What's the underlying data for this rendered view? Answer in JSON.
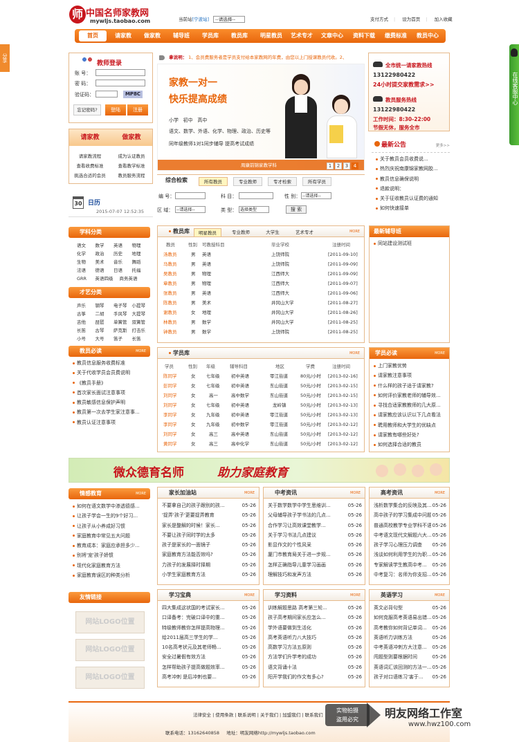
{
  "site": {
    "logo_glyph": "师",
    "logo_title": "中国名师家教网",
    "logo_url": "mywljs.taobao.com",
    "location_label": "当前站",
    "location_value": "[宁波站]",
    "location_select": "--请选择--",
    "links": [
      "支付方式",
      "设为首页",
      "加入收藏"
    ]
  },
  "nav": [
    "首页",
    "请家教",
    "做家教",
    "辅导班",
    "学员库",
    "教员库",
    "明星教员",
    "艺术专才",
    "文章中心",
    "资料下载",
    "缴费标准",
    "教员中心"
  ],
  "side_float": {
    "left": "分享",
    "right": "在线客服中心"
  },
  "login": {
    "title": "教师登录",
    "user": "账 号：",
    "pass": "密 码：",
    "code": "验证码：",
    "captcha": "MP8C",
    "forgot": "忘记密码?",
    "login_btn": "登陆",
    "reg_btn": "注册"
  },
  "guide": {
    "tab1": "请家教",
    "tab2": "做家教",
    "items1": [
      "请家教流程",
      "查看收费标准",
      "挑选合适的会员"
    ],
    "items2": [
      "成为认证教员",
      "查看教学标准",
      "教员服务流程"
    ]
  },
  "calendar": {
    "num": "30",
    "title": "日历",
    "date": "2015-07-07 12:52:35"
  },
  "notice": {
    "label": "拿说明：",
    "text": "1、会员费服务者是学员支付给本家教网的年费，由您以上门授课教员代收。2、"
  },
  "banner": {
    "line1": "家教一对一",
    "line2": "快乐提高成绩",
    "grades": "小学   初中   高中",
    "subjects": "语文、数学、外语、化学、物理、政治、历史等",
    "promo": "同年级教师1对1同步辅导 提高考试成绩",
    "caption": "周康前锦家教学科",
    "pages": [
      "1",
      "2",
      "3",
      "4"
    ]
  },
  "search": {
    "title": "综合检索",
    "tabs": [
      "所有教员",
      "专业教师",
      "专才检索",
      "所有学员"
    ],
    "id_label": "编 号：",
    "subject_label": "科 目：",
    "gender_label": "性 别：",
    "area_label": "区 域：",
    "type_label": "类 型：",
    "select_default": "--请选择--",
    "type_default": "选择类型",
    "btn": "搜 索"
  },
  "hotline": {
    "t1": "全市统一请家教热线",
    "p1": "13122980422",
    "s1": "24小时提交家教需求>>",
    "t2": "教员服务热线",
    "p2": "13122980422",
    "h1": "工作时间：8:30-22:00",
    "h2": "节假无休，服务全市"
  },
  "announce": {
    "title": "最新公告",
    "more": "更多>>",
    "items": [
      "关于教员会员收费说...",
      "热烈庆祝南康锦家教网胶...",
      "教员信息确保说明",
      "退款说明：",
      "关于征收教员认证费的通知",
      "如何快速接单"
    ]
  },
  "subjects": {
    "title": "学科分类",
    "items": [
      "语文",
      "数学",
      "英语",
      "物理",
      "化学",
      "政治",
      "历史",
      "地理",
      "生物",
      "美术",
      "音乐",
      "舞蹈",
      "法语",
      "德语",
      "日语",
      "托福",
      "GRR",
      "英语四级",
      "商务英语",
      ""
    ]
  },
  "arts": {
    "title": "才艺分类",
    "items": [
      "声乐",
      "钢琴",
      "电子琴",
      "小提琴",
      "古筝",
      "二胡",
      "手风琴",
      "大提琴",
      "吉他",
      "琵琶",
      "单簧管",
      "双簧管",
      "长笛",
      "古琴",
      "萨克斯",
      "打击乐",
      "小号",
      "大号",
      "笛子",
      "长笛"
    ]
  },
  "tutor_must": {
    "title": "教员必读",
    "more": "MORE",
    "items": [
      "教员信息服务收费标准",
      "关于代收学员会员费说明",
      "《教员手册》",
      "首次家长面试注意事项",
      "教员敏感信息保护声明",
      "教员第一次去学生家注意事...",
      "教员认证注意事项"
    ]
  },
  "tutor_db": {
    "title": "教员库",
    "more": "MORE",
    "tabs": [
      "明星教员",
      "专业教师",
      "大学生",
      "艺术专才"
    ],
    "headers": [
      "教员",
      "性别",
      "可教授科目",
      "毕业学校",
      "注册时间"
    ],
    "rows": [
      [
        "汤教员",
        "男",
        "英语",
        "上饶师院",
        "[2011-09-10]"
      ],
      [
        "马教员",
        "男",
        "英语",
        "上饶师院",
        "[2011-09-09]"
      ],
      [
        "吴教员",
        "男",
        "物理",
        "江西师大",
        "[2011-09-09]"
      ],
      [
        "章教员",
        "男",
        "物理",
        "江西师大",
        "[2011-09-07]"
      ],
      [
        "张教员",
        "男",
        "英语",
        "江西师大",
        "[2011-09-06]"
      ],
      [
        "陈教员",
        "男",
        "美术",
        "井冈山大学",
        "[2011-08-27]"
      ],
      [
        "谢教员",
        "女",
        "地理",
        "井冈山大学",
        "[2011-08-26]"
      ],
      [
        "林教员",
        "男",
        "数学",
        "井冈山大学",
        "[2011-08-25]"
      ],
      [
        "钟教员",
        "男",
        "数学",
        "上饶师院",
        "[2011-08-25]"
      ]
    ]
  },
  "latest_class": {
    "title": "最新辅导班",
    "items": [
      "同站建设测试班"
    ]
  },
  "student_db": {
    "title": "学员库",
    "more": "MORE",
    "headers": [
      "学员",
      "性别",
      "年级",
      "辅导科目",
      "地区",
      "学费",
      "注册时间"
    ],
    "rows": [
      [
        "陈同学",
        "女",
        "七年级",
        "初中英语",
        "零江街道",
        "80元/小时",
        "[2013-02-16]"
      ],
      [
        "彭同学",
        "女",
        "七年级",
        "初中英语",
        "东山街道",
        "50元/小时",
        "[2013-02-15]"
      ],
      [
        "刘同学",
        "女",
        "高一",
        "高中数学",
        "东山街道",
        "50元/小时",
        "[2013-02-15]"
      ],
      [
        "刘同学",
        "女",
        "七年级",
        "初中英语",
        "龙岭镇",
        "50元/小时",
        "[2013-02-13]"
      ],
      [
        "李同学",
        "女",
        "九年级",
        "初中英语",
        "零江街道",
        "50元/小时",
        "[2013-02-13]"
      ],
      [
        "李同学",
        "女",
        "九年级",
        "初中数学",
        "零江街道",
        "50元/小时",
        "[2013-02-12]"
      ],
      [
        "刘同学",
        "女",
        "高三",
        "高中英语",
        "东山街道",
        "50元/小时",
        "[2013-02-12]"
      ],
      [
        "黄同学",
        "女",
        "高三",
        "高中化学",
        "东山街道",
        "50元/小时",
        "[2013-02-12]"
      ]
    ]
  },
  "student_must": {
    "title": "学员必读",
    "more": "MORE",
    "items": [
      "上门家教优势",
      "请家教注意事项",
      "什么样的孩子适于请家教?",
      "如何评价家教老师的辅导效...",
      "寻找合适家教教师的几大原...",
      "请家教应该认识以下几点看法",
      "聘用教师和大学生的优缺点",
      "请家教有哪些好处?",
      "如何选择合适的教员"
    ]
  },
  "slogan": {
    "left": "微众德育名师",
    "right": "助力家庭教育"
  },
  "emotion": {
    "title": "情感教育",
    "more": "MORE",
    "items": [
      "如何在语文数学中渗透德感...",
      "让孩子学会一生的9个好习...",
      "让孩子从小养成好习惯",
      "家庭教育中常见五大问题",
      "教育成本：家庭应承担多少...",
      "别将'宠'孩子娇惯",
      "现代化家庭教育方法",
      "家庭教育误区的种类分析"
    ]
  },
  "friends": {
    "title": "友情链接",
    "logos": [
      "网站LOGO位置",
      "网站LOGO位置",
      "网站LOGO位置"
    ]
  },
  "parents": {
    "title": "家长加油站",
    "more": "MORE",
    "items": [
      [
        "不要拿自己的孩子跟别的孩...",
        "05-26"
      ],
      [
        "'捉弄'孩子'更要捉弄教育",
        "05-26"
      ],
      [
        "家长是整解的时候！家长...",
        "05-26"
      ],
      [
        "不要让孩子同时学的太多",
        "05-26"
      ],
      [
        "孩子是家长的一面镜子",
        "05-26"
      ],
      [
        "家庭教育方法能否效吗?",
        "05-26"
      ],
      [
        "力孩子的发展择时择期",
        "05-26"
      ],
      [
        "小学生家庭教育方法",
        "05-26"
      ]
    ]
  },
  "zhongkao": {
    "title": "中考资讯",
    "more": "MORE",
    "items": [
      [
        "关于数学数学中学生思维训...",
        "05-26"
      ],
      [
        "父母辅导孩子学书法的几点...",
        "05-26"
      ],
      [
        "合作学习让高效课堂教学...",
        "05-26"
      ],
      [
        "关于学习书法几点建议",
        "05-26"
      ],
      [
        "影显作文的个性风采",
        "05-26"
      ],
      [
        "厦门市教育局关于进一步规...",
        "05-26"
      ],
      [
        "怎样正确指导儿童学习画画",
        "05-26"
      ],
      [
        "理解技巧和发声方法",
        "05-26"
      ]
    ]
  },
  "gaokao": {
    "title": "高考资讯",
    "more": "MORE",
    "items": [
      [
        "浅析数学集合的反映及其...",
        "05-26"
      ],
      [
        "高中孩子的学习集成中问题...",
        "05-26"
      ],
      [
        "普通高校教学专业学科不语...",
        "05-26"
      ],
      [
        "中考语文现代文解题六大...",
        "05-26"
      ],
      [
        "孩子学习心理压力调查",
        "05-26"
      ],
      [
        "浅谈如何利用学生的为职...",
        "05-26"
      ],
      [
        "专家解读学生教高中考...",
        "05-26"
      ],
      [
        "中考复习：名师为你支招...",
        "05-26"
      ]
    ]
  },
  "study_treasure": {
    "title": "学习宝典",
    "more": "MORE",
    "items": [
      [
        "四大集成这状国的考试家长...",
        "05-26"
      ],
      [
        "口译备考：完破口译中的重...",
        "05-26"
      ],
      [
        "特级教师教你怎样提高物理...",
        "05-26"
      ],
      [
        "给2011届高三学生的学...",
        "05-26"
      ],
      [
        "10名高考状元及其老师畅...",
        "05-26"
      ],
      [
        "安全过暑假有效方法",
        "05-26"
      ],
      [
        "怎样帮助孩子提高做题效率...",
        "05-26"
      ],
      [
        "高考冲刺 是后冲刺也要...",
        "05-26"
      ]
    ]
  },
  "study_material": {
    "title": "学习资料",
    "more": "MORE",
    "items": [
      [
        "训练解题思路 高考第三轮...",
        "05-26"
      ],
      [
        "孩子高考期间家长应怎么...",
        "05-26"
      ],
      [
        "学外语要做到生活化",
        "05-26"
      ],
      [
        "高考英语听力八大技巧",
        "05-26"
      ],
      [
        "高数学习方法五原则",
        "05-26"
      ],
      [
        "方法学们升学考的成功",
        "05-26"
      ],
      [
        "语文背诵十法",
        "05-26"
      ],
      [
        "阳开学我们的作文有多心?",
        "05-26"
      ]
    ]
  },
  "english": {
    "title": "英语学习",
    "more": "MORE",
    "items": [
      [
        "英文必背句型",
        "05-26"
      ],
      [
        "如何克服高考英语易出错...",
        "05-26"
      ],
      [
        "高考教你如何背记单词...",
        "05-26"
      ],
      [
        "英语听力训练方法",
        "05-26"
      ],
      [
        "中考英语冲刺方大注意...",
        "05-26"
      ],
      [
        "闯题型则要根据时间",
        "05-26"
      ],
      [
        "英语词汇该回测的方法一...",
        "05-26"
      ],
      [
        "孩子对口语练习'害于...",
        "05-26"
      ]
    ]
  },
  "footer": {
    "links": "法律安全 | 使用条款 | 联系说明 | 关于我们 | 加盟我们 | 联系我们",
    "contact": "联系电话：13162640858     地址：明友网络http://mywljs.taobao.com",
    "watermark1": "实物拍摄",
    "watermark2": "盗用必究",
    "studio": "明友网络工作室",
    "studio_url": "www.hwz100.com"
  },
  "colors": {
    "accent": "#e8660c",
    "nav": "#f07a1c"
  }
}
